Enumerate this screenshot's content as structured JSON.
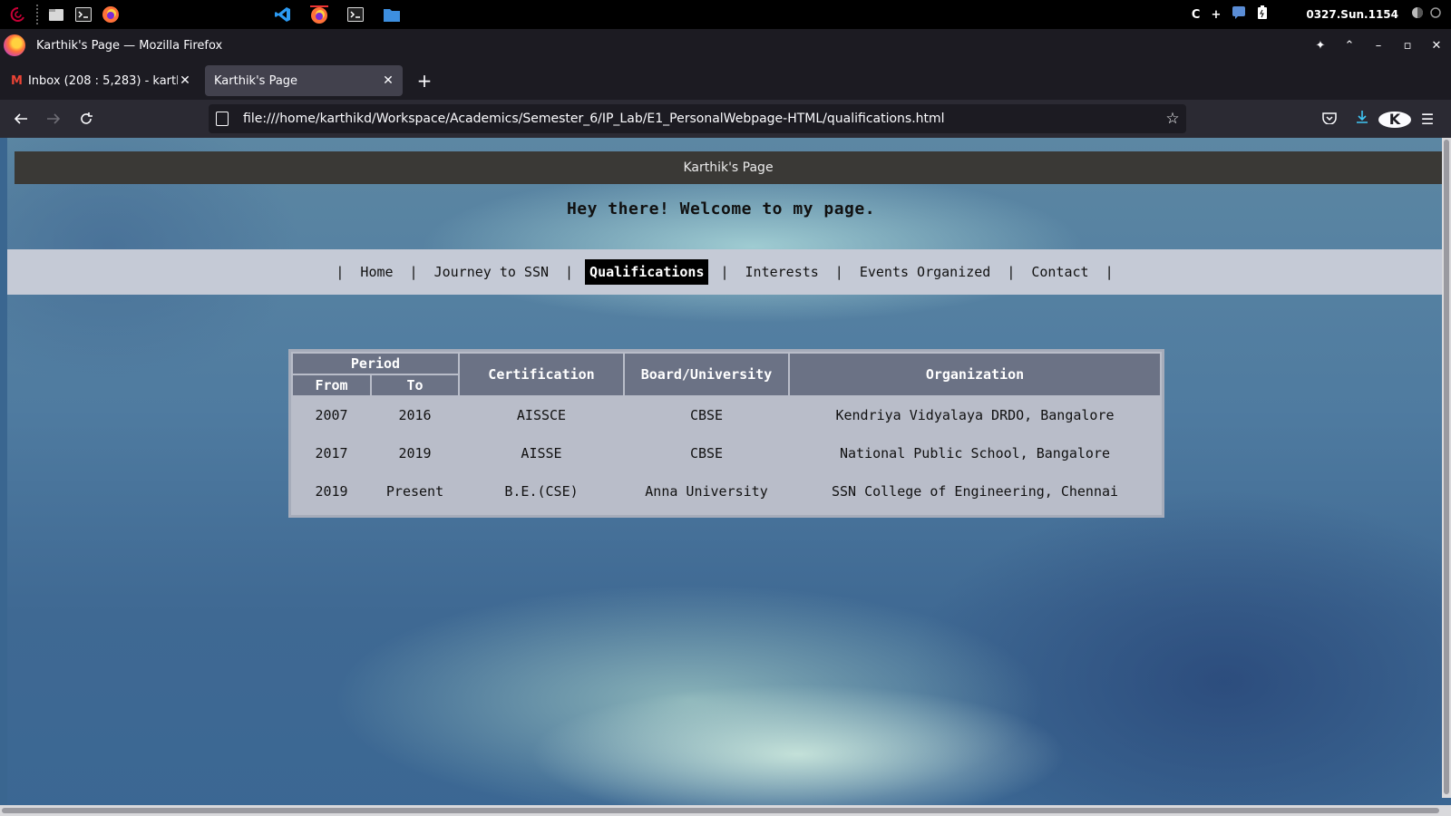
{
  "taskbar": {
    "clock": "0327.Sun.1154",
    "tray_letter": "C",
    "tray_plus": "+"
  },
  "window": {
    "title": "Karthik's Page — Mozilla Firefox"
  },
  "tabs": [
    {
      "label": "Inbox (208 : 5,283) - karthik",
      "active": false
    },
    {
      "label": "Karthik's Page",
      "active": true
    }
  ],
  "navbar": {
    "url": "file:///home/karthikd/Workspace/Academics/Semester_6/IP_Lab/E1_PersonalWebpage-HTML/qualifications.html",
    "account_initial": "K"
  },
  "page": {
    "header_title": "Karthik's Page",
    "welcome": "Hey there! Welcome to my page.",
    "menu": [
      {
        "label": "Home",
        "active": false
      },
      {
        "label": "Journey to SSN",
        "active": false
      },
      {
        "label": "Qualifications",
        "active": true
      },
      {
        "label": "Interests",
        "active": false
      },
      {
        "label": "Events Organized",
        "active": false
      },
      {
        "label": "Contact",
        "active": false
      }
    ],
    "menu_separator": "|",
    "table": {
      "headers": {
        "period": "Period",
        "from": "From",
        "to": "To",
        "certification": "Certification",
        "board": "Board/University",
        "organization": "Organization"
      },
      "rows": [
        [
          "2007",
          "2016",
          "AISSCE",
          "CBSE",
          "Kendriya Vidyalaya DRDO, Bangalore"
        ],
        [
          "2017",
          "2019",
          "AISSE",
          "CBSE",
          "National Public School, Bangalore"
        ],
        [
          "2019",
          "Present",
          "B.E.(CSE)",
          "Anna University",
          "SSN College of Engineering, Chennai"
        ]
      ]
    }
  }
}
